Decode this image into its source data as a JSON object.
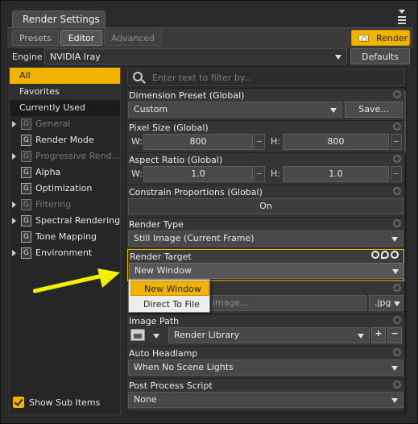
{
  "window": {
    "title": "Render Settings"
  },
  "tabs": {
    "presets": "Presets",
    "editor": "Editor",
    "advanced": "Advanced"
  },
  "render_button": "Render",
  "engine": {
    "label": "Engine :",
    "value": "NVIDIA Iray",
    "defaults": "Defaults"
  },
  "filter": {
    "placeholder": "Enter text to filter by..."
  },
  "nav": {
    "top": [
      "All",
      "Favorites",
      "Currently Used"
    ],
    "categories": [
      {
        "label": "General",
        "expandable": true,
        "dim": true
      },
      {
        "label": "Render Mode",
        "expandable": false,
        "dim": false
      },
      {
        "label": "Progressive Rend...",
        "expandable": true,
        "dim": true
      },
      {
        "label": "Alpha",
        "expandable": false,
        "dim": false
      },
      {
        "label": "Optimization",
        "expandable": false,
        "dim": false
      },
      {
        "label": "Filtering",
        "expandable": true,
        "dim": true
      },
      {
        "label": "Spectral Rendering",
        "expandable": true,
        "dim": false
      },
      {
        "label": "Tone Mapping",
        "expandable": false,
        "dim": false
      },
      {
        "label": "Environment",
        "expandable": true,
        "dim": false
      }
    ],
    "show_sub_items": "Show Sub Items"
  },
  "props": {
    "dimension_preset": {
      "label": "Dimension Preset (Global)",
      "value": "Custom",
      "save": "Save..."
    },
    "pixel_size": {
      "label": "Pixel Size (Global)",
      "w_label": "W:",
      "w": "800",
      "h_label": "H:",
      "h": "800"
    },
    "aspect_ratio": {
      "label": "Aspect Ratio (Global)",
      "w_label": "W:",
      "w": "1.0",
      "h_label": "H:",
      "h": "1.0"
    },
    "constrain": {
      "label": "Constrain Proportions (Global)",
      "value": "On"
    },
    "render_type": {
      "label": "Render Type",
      "value": "Still Image (Current Frame)"
    },
    "render_target": {
      "label": "Render Target",
      "value": "New Window"
    },
    "image_name": {
      "placeholder_partial": "image...",
      "ext": ".jpg"
    },
    "image_path": {
      "label": "Image Path",
      "value": "Render Library",
      "plus": "+",
      "minus": "−"
    },
    "auto_headlamp": {
      "label": "Auto Headlamp",
      "value": "When No Scene Lights"
    },
    "post_process": {
      "label": "Post Process Script",
      "value": "None"
    }
  },
  "dropdown": {
    "options": [
      "New Window",
      "Direct To File"
    ],
    "selected": "New Window"
  },
  "colors": {
    "accent": "#f2b300",
    "background": "#2a2a2a",
    "arrow": "#f2f200"
  }
}
